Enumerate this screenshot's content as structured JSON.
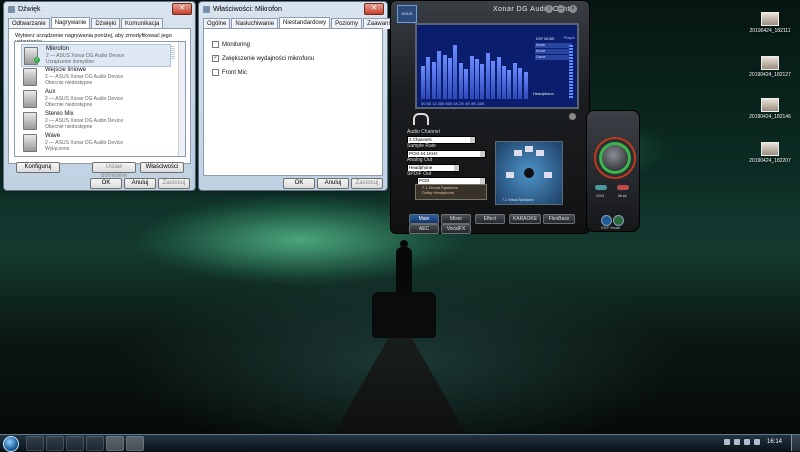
{
  "sound_window": {
    "title": "Dźwięk",
    "tabs": [
      "Odtwarzanie",
      "Nagrywanie",
      "Dźwięki",
      "Komunikacja"
    ],
    "instruction": "Wybierz urządzenie nagrywania poniżej, aby zmodyfikować jego ustawienia:",
    "devices": [
      {
        "name": "Mikrofon",
        "desc": "2 — ASUS Xonar DG Audio Device",
        "status": "Urządzenie domyślne"
      },
      {
        "name": "Wejście liniowe",
        "desc": "2 — ASUS Xonar DG Audio Device",
        "status": "Obecnie niedostępne"
      },
      {
        "name": "Aux",
        "desc": "2 — ASUS Xonar DG Audio Device",
        "status": "Obecnie niedostępne"
      },
      {
        "name": "Stereo Mix",
        "desc": "2 — ASUS Xonar DG Audio Device",
        "status": "Obecnie niedostępne"
      },
      {
        "name": "Wave",
        "desc": "2 — ASUS Xonar DG Audio Device",
        "status": "Wyłączone"
      }
    ],
    "configure_label": "Konfiguruj",
    "set_default_label": "Ustaw domyślne",
    "properties_label": "Właściwości",
    "ok_label": "OK",
    "cancel_label": "Anuluj",
    "apply_label": "Zastosuj"
  },
  "mic_window": {
    "title": "Właściwości: Mikrofon",
    "tabs": [
      "Ogólne",
      "Nasłuchiwanie",
      "Niestandardowy",
      "Poziomy",
      "Zaawansowane"
    ],
    "options": [
      {
        "label": "Monitoring",
        "checked": false
      },
      {
        "label": "Zwiększenie wydajności mikrofonu",
        "checked": true
      },
      {
        "label": "Front Mic",
        "checked": false
      }
    ],
    "ok_label": "OK",
    "cancel_label": "Anuluj",
    "apply_label": "Zastosuj"
  },
  "xonar": {
    "title": "Xonar DG Audio Center",
    "logo_text": "ASUS",
    "eq_freqs": "30 60 12 250 500 1K 2K 4K 8K 16K",
    "screen_labels": [
      "DSP MODE",
      "Music",
      "Movie",
      "Game",
      "Headphone"
    ],
    "screen_side_label": "Player",
    "eq_levels": [
      0.55,
      0.7,
      0.62,
      0.8,
      0.74,
      0.68,
      0.9,
      0.6,
      0.5,
      0.72,
      0.66,
      0.58,
      0.77,
      0.63,
      0.7,
      0.55,
      0.48,
      0.6,
      0.52,
      0.45
    ],
    "audio_channel_label": "Audio Channel",
    "audio_channel_value": "2 Channels",
    "sample_rate_label": "Sample Rate",
    "sample_rate_value": "PCM 44.1KHz",
    "analog_out_label": "Analog Out",
    "analog_out_value": "Headphone",
    "spdif_label": "SPDIF Out",
    "spdif_value": "PCM",
    "spdif_options": [
      "7.1 Virtual Speakers",
      "Dolby Headphone"
    ],
    "speaker_label": "7.1 Virtual Speakers",
    "bottom_tabs": [
      "Main",
      "Mixer",
      "Effect",
      "KARAOKE",
      "FlexBass"
    ],
    "bottom_tabs2": [
      "AEC",
      "VocalFX"
    ],
    "side_svn": "SVN",
    "side_mute": "Mute",
    "side_dsp": "DSP Mode"
  },
  "desktop_icons": [
    {
      "label": "20190424_182111"
    },
    {
      "label": "20190424_182127"
    },
    {
      "label": "20190424_182146"
    },
    {
      "label": "20190424_182207"
    }
  ],
  "taskbar": {
    "clock": "16:14"
  },
  "colors": {
    "xonar_screen": "#0b1e6e",
    "knob_ring_red": "#c33a1c",
    "knob_ring_green": "#38b84a"
  }
}
